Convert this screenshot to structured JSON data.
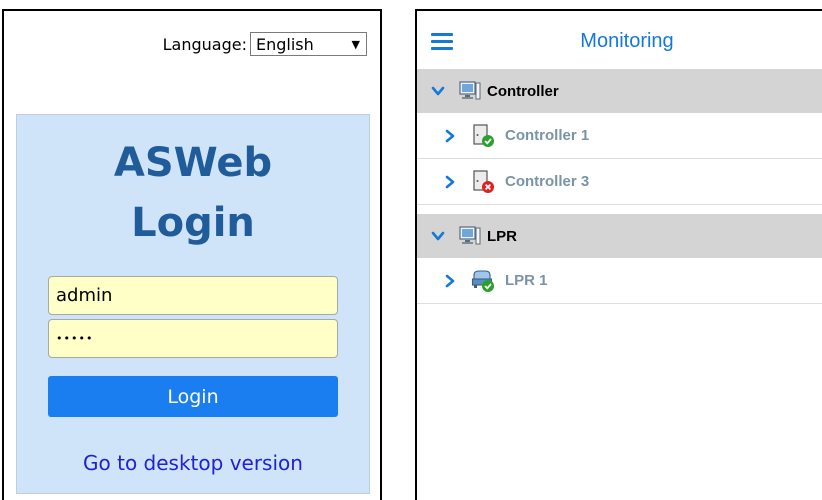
{
  "login": {
    "language_label": "Language:",
    "language_value": "English",
    "language_arrow": "▼",
    "title_line1": "ASWeb",
    "title_line2": "Login",
    "username_value": "admin",
    "password_masked": "•••••",
    "login_button_label": "Login",
    "desktop_link_label": "Go to desktop version"
  },
  "monitoring": {
    "title": "Monitoring",
    "groups": [
      {
        "label": "Controller",
        "icon": "computer-icon",
        "items": [
          {
            "label": "Controller 1",
            "icon": "door-controller-ok-icon",
            "status": "ok"
          },
          {
            "label": "Controller 3",
            "icon": "door-controller-error-icon",
            "status": "error"
          }
        ]
      },
      {
        "label": "LPR",
        "icon": "computer-icon",
        "items": [
          {
            "label": "LPR 1",
            "icon": "lpr-device-ok-icon",
            "status": "ok"
          }
        ]
      }
    ]
  },
  "colors": {
    "accent": "#1479d9",
    "login_box_bg": "#cfe3f9",
    "title_blue": "#1f5c99",
    "input_bg": "#ffffc8",
    "button_blue": "#1a7df0",
    "link_blue": "#2121d6",
    "group_bg": "#d4d4d4",
    "item_text": "#7b93a8",
    "status_ok": "#2ca02c",
    "status_error": "#e02020"
  }
}
